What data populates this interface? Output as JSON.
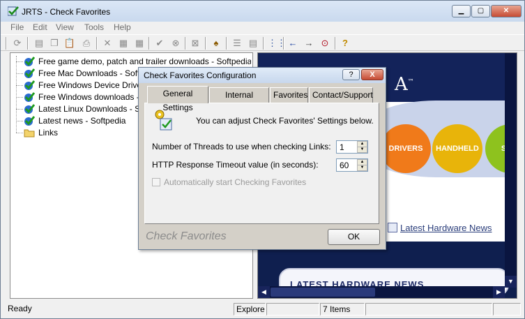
{
  "window": {
    "title": "JRTS - Check Favorites"
  },
  "menu": [
    "File",
    "Edit",
    "View",
    "Tools",
    "Help"
  ],
  "tree": {
    "items": [
      {
        "label": "Free game demo, patch and trailer downloads - Softpedia",
        "icon": "favorite-check-icon"
      },
      {
        "label": "Free Mac Downloads - Softped",
        "icon": "favorite-check-icon"
      },
      {
        "label": "Free Windows Device Driver D",
        "icon": "favorite-check-icon"
      },
      {
        "label": "Free Windows downloads - So",
        "icon": "favorite-check-icon"
      },
      {
        "label": "Latest Linux Downloads - Softp",
        "icon": "favorite-check-icon"
      },
      {
        "label": "Latest news - Softpedia",
        "icon": "favorite-check-icon"
      },
      {
        "label": "Links",
        "icon": "folder-icon"
      }
    ]
  },
  "browser": {
    "logo_fragment": "A",
    "logo_tm": "™",
    "buttons": [
      "DRIVERS",
      "HANDHELD",
      "SCRI"
    ],
    "link": "Latest Hardware News",
    "banner": "LATEST HARDWARE NEWS"
  },
  "status": {
    "left": "Ready",
    "mode": "Explore",
    "count": "7 Items"
  },
  "dialog": {
    "title": "Check Favorites Configuration",
    "help_label": "?",
    "close_label": "X",
    "tabs": [
      "General Settings",
      "Internal Browser",
      "Favorites",
      "Contact/Support"
    ],
    "intro": "You can adjust Check Favorites' Settings below.",
    "threads_label": "Number of Threads to use when checking Links:",
    "threads_value": "1",
    "timeout_label": "HTTP Response Timeout value (in seconds):",
    "timeout_value": "60",
    "autostart_label": "Automatically start Checking Favorites",
    "brand": "Check Favorites",
    "ok_label": "OK"
  },
  "colors": {
    "browser_bg": "#13235a",
    "orange_blob": "#f07a1a",
    "yellow_blob": "#e8b40a",
    "green_blob": "#8ec21e"
  }
}
